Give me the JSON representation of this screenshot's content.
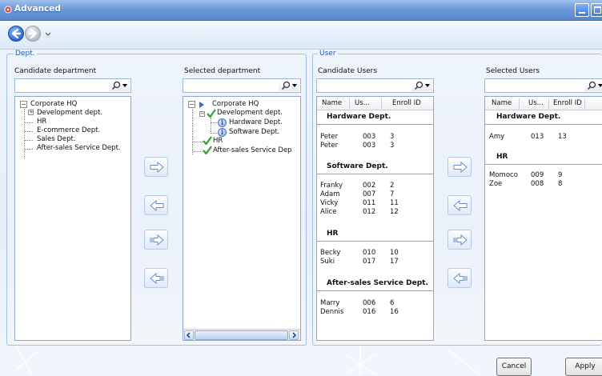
{
  "window": {
    "title": "Advanced",
    "icons": {
      "app": "gear-icon",
      "minimize": "minimize-icon",
      "maximize": "maximize-icon"
    }
  },
  "nav": {
    "back_icon": "back-arrow-icon",
    "forward_icon": "forward-arrow-icon",
    "dropdown_icon": "chevron-down-icon"
  },
  "dept": {
    "group_label": "Dept.",
    "candidate": {
      "label": "Candidate department",
      "search_value": "",
      "tree": [
        {
          "label": "Corporate HQ",
          "level": 0,
          "expander": "minus"
        },
        {
          "label": "Development dept.",
          "level": 1,
          "expander": "plus"
        },
        {
          "label": "HR",
          "level": 1
        },
        {
          "label": "E-commerce Dept.",
          "level": 1
        },
        {
          "label": "Sales Dept.",
          "level": 1
        },
        {
          "label": "After-sales Service Dept.",
          "level": 1
        }
      ]
    },
    "selected": {
      "label": "Selected department",
      "search_value": "",
      "tree": [
        {
          "label": "Corporate HQ",
          "level": 0,
          "icon": "triangle-icon"
        },
        {
          "label": "Development dept.",
          "level": 1,
          "icon": "check-icon"
        },
        {
          "label": "Hardware Dept.",
          "level": 2,
          "icon": "info-icon"
        },
        {
          "label": "Software Dept.",
          "level": 2,
          "icon": "info-icon"
        },
        {
          "label": "HR",
          "level": 1,
          "icon": "check-icon"
        },
        {
          "label": "After-sales Service Dep",
          "level": 1,
          "icon": "check-icon"
        }
      ]
    }
  },
  "user": {
    "group_label": "User",
    "candidate": {
      "label": "Candidate Users",
      "search_value": "",
      "columns": [
        "Name",
        "Us...",
        "Enroll ID"
      ],
      "groups": [
        {
          "title": "Hardware Dept.",
          "rows": [
            [
              "Peter",
              "003",
              "3"
            ],
            [
              "Peter",
              "003",
              "3"
            ]
          ]
        },
        {
          "title": "Software Dept.",
          "rows": [
            [
              "Franky",
              "002",
              "2"
            ],
            [
              "Adam",
              "007",
              "7"
            ],
            [
              "Vicky",
              "011",
              "11"
            ],
            [
              "Alice",
              "012",
              "12"
            ]
          ]
        },
        {
          "title": "HR",
          "rows": [
            [
              "Becky",
              "010",
              "10"
            ],
            [
              "Suki",
              "017",
              "17"
            ]
          ]
        },
        {
          "title": "After-sales Service Dept.",
          "rows": [
            [
              "Marry",
              "006",
              "6"
            ],
            [
              "Dennis",
              "016",
              "16"
            ]
          ]
        }
      ]
    },
    "selected": {
      "label": "Selected Users",
      "search_value": "",
      "columns": [
        "Name",
        "Us...",
        "Enroll ID"
      ],
      "groups": [
        {
          "title": "Hardware Dept.",
          "rows": [
            [
              "Amy",
              "013",
              "13"
            ]
          ]
        },
        {
          "title": "HR",
          "rows": [
            [
              "Momoco",
              "009",
              "9"
            ],
            [
              "Zoe",
              "008",
              "8"
            ]
          ]
        }
      ]
    }
  },
  "transfer_icons": [
    "move-right-icon",
    "move-left-icon",
    "move-all-right-icon",
    "move-all-left-icon"
  ],
  "buttons": {
    "cancel": "Cancel",
    "apply": "Apply"
  }
}
